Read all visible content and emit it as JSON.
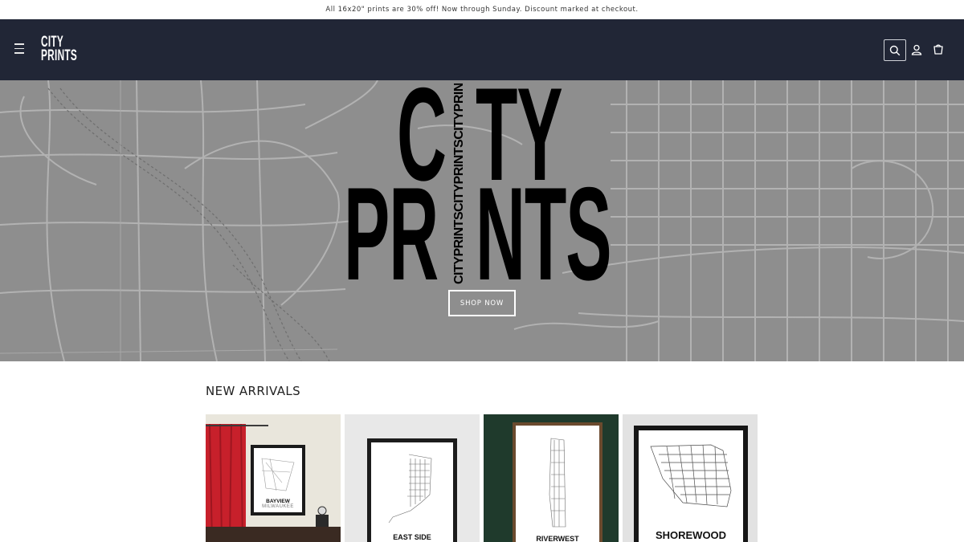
{
  "announcement": "All 16x20\" prints are 30% off! Now through Sunday. Discount marked at checkout.",
  "header": {
    "logo_top": "CITY",
    "logo_bottom": "PRINTS",
    "icons": [
      "menu-icon",
      "search-icon",
      "account-icon",
      "cart-icon"
    ],
    "background": "#212636"
  },
  "hero": {
    "title_line1": "CITY",
    "title_line2": "PRINTS",
    "vertical_text": "CITYPRINTSCITYPRINTSCITYPRINTS",
    "button_label": "SHOP NOW",
    "background": "#8e8e8e"
  },
  "new_arrivals": {
    "title": "NEW ARRIVALS",
    "products": [
      {
        "label": "BAYVIEW",
        "sublabel": "MILWAUKEE"
      },
      {
        "label": "EAST SIDE",
        "sublabel": ""
      },
      {
        "label": "RIVERWEST",
        "sublabel": ""
      },
      {
        "label": "SHOREWOOD",
        "sublabel": ""
      }
    ]
  }
}
